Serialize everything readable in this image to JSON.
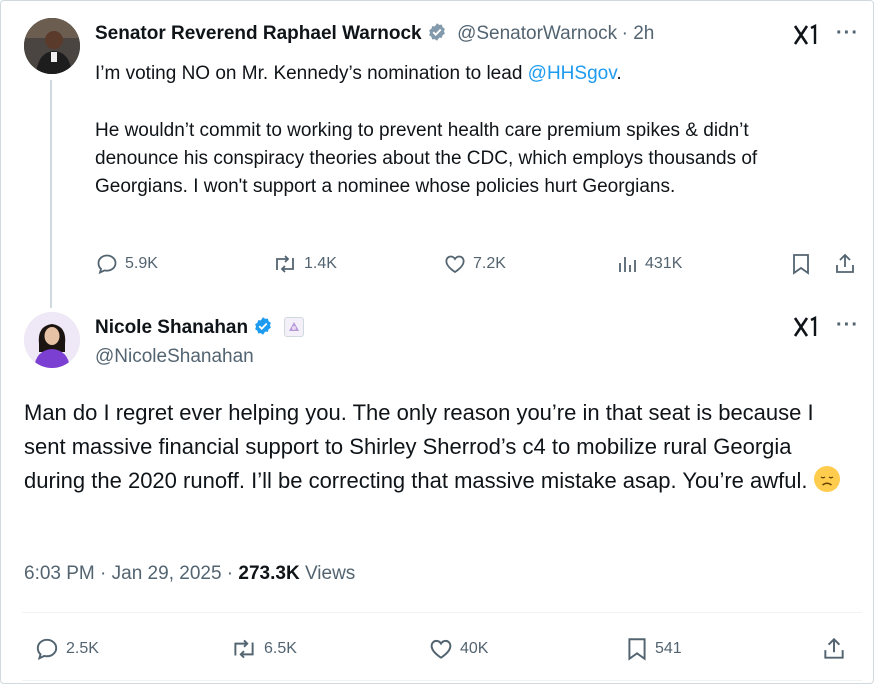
{
  "tweet1": {
    "author_name": "Senator Reverend Raphael Warnock",
    "handle": "@SenatorWarnock",
    "time": "· 2h",
    "text_line1_prefix": "I’m voting NO on Mr. Kennedy’s nomination to lead ",
    "mention": "@HHSgov",
    "text_line1_suffix": ".",
    "paragraph2": "He wouldn’t commit to working to prevent health care premium spikes & didn’t denounce his conspiracy theories about the CDC, which employs thousands of Georgians. I won't support a nominee whose policies hurt Georgians.",
    "stats": {
      "replies": "5.9K",
      "reposts": "1.4K",
      "likes": "7.2K",
      "views": "431K"
    }
  },
  "tweet2": {
    "author_name": "Nicole Shanahan",
    "handle": "@NicoleShanahan",
    "text": "Man do I regret ever helping you. The only reason you’re in that seat is because I sent massive financial support to Shirley Sherrod’s c4 to mobilize rural Georgia during the 2020 runoff. I’ll be correcting that massive mistake asap. You’re awful.",
    "emoji": "😞",
    "timestamp": "6:03 PM · Jan 29, 2025 · ",
    "views_count": "273.3K",
    "views_label": " Views",
    "stats": {
      "replies": "2.5K",
      "reposts": "6.5K",
      "likes": "40K",
      "bookmarks": "541"
    }
  },
  "colors": {
    "text": "#0f1419",
    "secondary": "#536471",
    "accent": "#1d9bf0",
    "border": "#cfd9de"
  },
  "icons": [
    "verified-badge-icon",
    "grok-icon",
    "more-icon",
    "reply-icon",
    "repost-icon",
    "like-icon",
    "views-icon",
    "bookmark-icon",
    "share-icon",
    "affiliate-badge-icon"
  ]
}
